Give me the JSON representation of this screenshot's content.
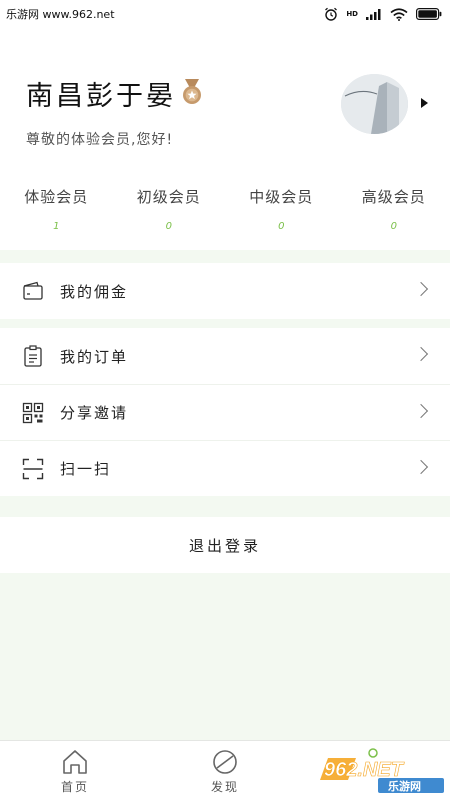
{
  "status_bar": {
    "source_text": "乐游网 www.962.net",
    "network_label": "HD"
  },
  "profile": {
    "user_name": "南昌彭于晏",
    "greeting": "尊敬的体验会员,您好!"
  },
  "levels": [
    {
      "name": "体验会员",
      "count": "1"
    },
    {
      "name": "初级会员",
      "count": "0"
    },
    {
      "name": "中级会员",
      "count": "0"
    },
    {
      "name": "高级会员",
      "count": "0"
    }
  ],
  "menu": {
    "commission": "我的佣金",
    "orders": "我的订单",
    "share_invite": "分享邀请",
    "scan": "扫一扫",
    "logout": "退出登录"
  },
  "tabs": [
    {
      "label": "首页",
      "icon": "home-icon"
    },
    {
      "label": "发现",
      "icon": "compass-icon"
    }
  ],
  "watermark": {
    "brand": "962.NET",
    "subtitle": "乐游网"
  },
  "colors": {
    "accent": "#7cc04a",
    "page_bg": "#f3f9f1",
    "watermark_orange": "#f5a623"
  }
}
